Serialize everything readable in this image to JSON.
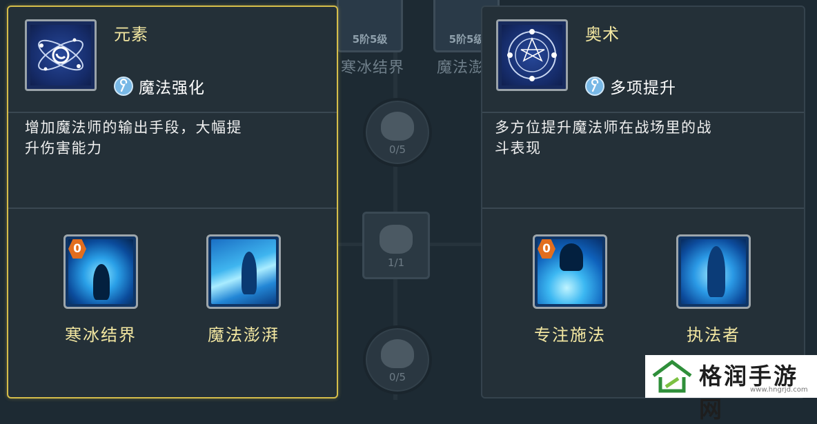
{
  "background_tree": {
    "top_cards": [
      {
        "level": "5阶5级",
        "name": "寒冰结界"
      },
      {
        "level": "5阶5级",
        "name": "魔法澎"
      }
    ],
    "nodes": [
      {
        "progress": "0/5"
      },
      {
        "progress": "1/1"
      },
      {
        "progress": "0/5"
      }
    ]
  },
  "panels": [
    {
      "title": "元素",
      "tag": "魔法强化",
      "description": [
        "增加魔法师的输出手段，大幅提",
        "升伤害能力"
      ],
      "skills": [
        {
          "name": "寒冰结界",
          "level": "0"
        },
        {
          "name": "魔法澎湃",
          "level": ""
        }
      ],
      "selected": true,
      "icon": "atom-orbit-icon"
    },
    {
      "title": "奥术",
      "tag": "多项提升",
      "description": [
        "多方位提升魔法师在战场里的战",
        "斗表现"
      ],
      "skills": [
        {
          "name": "专注施法",
          "level": "0"
        },
        {
          "name": "执法者",
          "level": ""
        }
      ],
      "selected": false,
      "icon": "magic-circle-icon"
    }
  ],
  "watermark": {
    "text": "格润手游网",
    "url": "www.hngrjd.com"
  },
  "colors": {
    "selected_border": "#d6be4a",
    "title": "#f3e7a1",
    "panel_bg": "#243038"
  }
}
